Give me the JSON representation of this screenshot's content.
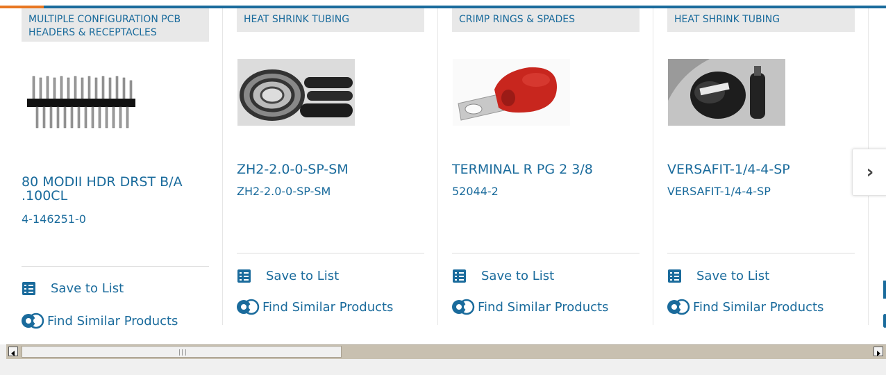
{
  "cards": [
    {
      "category": "MULTIPLE CONFIGURATION PCB HEADERS & RECEPTACLES",
      "title": "80 MODII HDR DRST B/A .100CL",
      "part_number": "4-146251-0",
      "save_label": "Save to List",
      "similar_label": "Find Similar Products"
    },
    {
      "category": "HEAT SHRINK TUBING",
      "title": "ZH2-2.0-0-SP-SM",
      "part_number": "ZH2-2.0-0-SP-SM",
      "save_label": "Save to List",
      "similar_label": "Find Similar Products"
    },
    {
      "category": "CRIMP RINGS & SPADES",
      "title": "TERMINAL R PG 2 3/8",
      "part_number": "52044-2",
      "save_label": "Save to List",
      "similar_label": "Find Similar Products"
    },
    {
      "category": "HEAT SHRINK TUBING",
      "title": "VERSAFIT-1/4-4-SP",
      "part_number": "VERSAFIT-1/4-4-SP",
      "save_label": "Save to List",
      "similar_label": "Find Similar Products"
    }
  ],
  "carousel": {
    "next_glyph": "›"
  },
  "colors": {
    "accent": "#1a6b9c",
    "top_highlight": "#e87722"
  }
}
